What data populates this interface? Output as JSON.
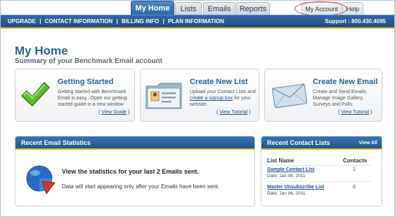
{
  "tabs": [
    {
      "label": "My Home",
      "active": true
    },
    {
      "label": "Lists",
      "active": false
    },
    {
      "label": "Emails",
      "active": false
    },
    {
      "label": "Reports",
      "active": false
    }
  ],
  "account_tab": "My Account",
  "help_tab": "Help",
  "topnav": {
    "links": [
      "UPGRADE",
      "CONTACT INFORMATION",
      "BILLING INFO",
      "PLAN INFORMATION"
    ],
    "separator": "|",
    "support": "Support : 800.430.4095"
  },
  "page": {
    "title": "My Home",
    "subtitle": "Summary of your Benchmark Email account"
  },
  "cards": {
    "getting_started": {
      "title": "Getting Started",
      "desc1": "Getting started with Benchmark",
      "desc2": "Email is easy...Open our getting",
      "desc3": "started guide in a new window",
      "link_pre": "( ",
      "link": "View Guide",
      "link_post": " )"
    },
    "create_list": {
      "title": "Create New List",
      "desc1": "Upload your Contact Lists and",
      "desc2_link": "create a signup box",
      "desc2_post": " for your",
      "desc3": "website.",
      "link_pre": "( ",
      "link": "View Tutorial",
      "link_post": " )"
    },
    "create_email": {
      "title": "Create New Email",
      "desc1": "Create and Send Emails.",
      "desc2": "Manage Image Gallery,",
      "desc3": "Surveys and Polls.",
      "link_pre": "( ",
      "link": "View Tutorial",
      "link_post": " )"
    }
  },
  "stats": {
    "title": "Recent Email Statistics",
    "main": "View the statistics for your last 2 Emails sent.",
    "sub": "Data will start appearing only after your Emails have been sent."
  },
  "contact_lists": {
    "title": "Recent Contact Lists",
    "view_all": "View All",
    "col_name": "List Name",
    "col_contacts": "Contacts",
    "rows": [
      {
        "name": "Sample Contact List",
        "date": "Date: Jan 06, 2011",
        "contacts": "1"
      },
      {
        "name": "Master Unsubscribe List",
        "date": "Date: Jan 06, 2011",
        "contacts": "0"
      }
    ]
  },
  "colors": {
    "brand_blue": "#2a66a6",
    "accent_gold": "#e6b530",
    "highlight_red": "#d33a2c"
  }
}
